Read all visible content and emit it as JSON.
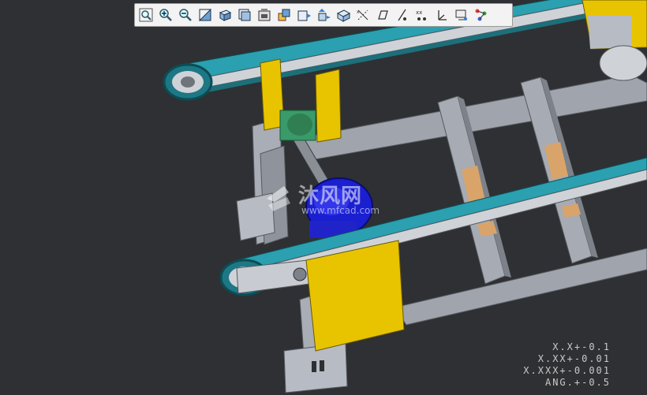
{
  "toolbar": {
    "buttons": [
      {
        "name": "refit-icon"
      },
      {
        "name": "zoom-in-icon"
      },
      {
        "name": "zoom-out-icon"
      },
      {
        "name": "repaint-icon"
      },
      {
        "name": "shaded-display-icon"
      },
      {
        "name": "saved-views-icon"
      },
      {
        "name": "view-manager-icon"
      },
      {
        "name": "named-views-icon"
      },
      {
        "name": "standard-orientation-icon"
      },
      {
        "name": "previous-view-icon"
      },
      {
        "name": "section-view-icon"
      },
      {
        "name": "datum-planes-icon"
      },
      {
        "name": "datum-axes-icon"
      },
      {
        "name": "datum-points-icon"
      },
      {
        "name": "coordinate-systems-icon"
      },
      {
        "name": "annotations-icon"
      },
      {
        "name": "spin-center-icon"
      },
      {
        "name": "appearance-icon"
      }
    ]
  },
  "tolerances": {
    "line1": "X.X+-0.1",
    "line2": "X.XX+-0.01",
    "line3": "X.XXX+-0.001",
    "line4": "ANG.+-0.5"
  },
  "watermark": {
    "name": "沐风网",
    "url": "www.mfcad.com"
  },
  "colors": {
    "background": "#2f3033",
    "frame": "#a6aab2",
    "belt": "#2aa0b0",
    "guard": "#e8c400",
    "motor": "#1a1fd0",
    "tab": "#d9a46a"
  }
}
